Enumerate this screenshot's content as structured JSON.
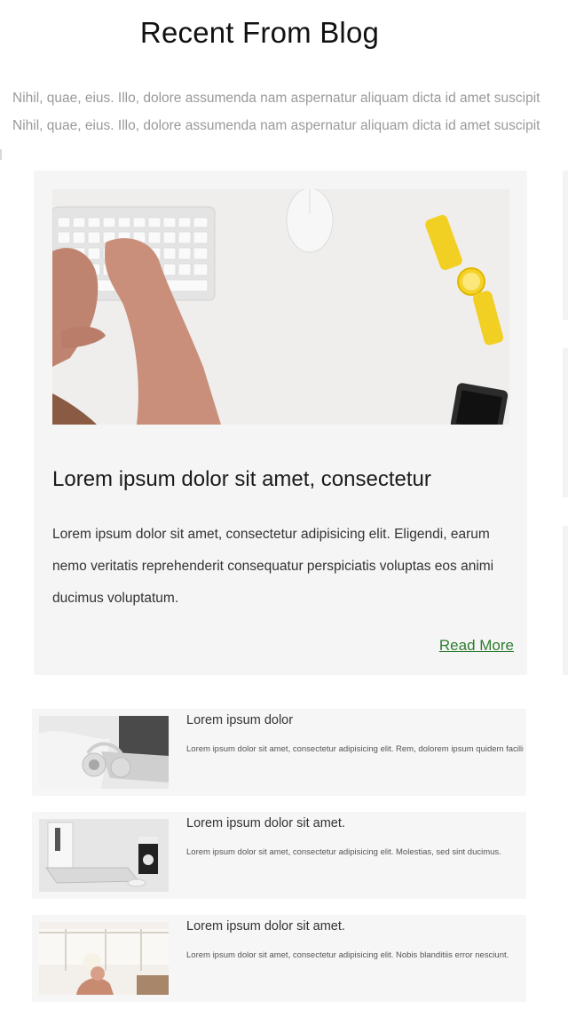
{
  "section": {
    "title": "Recent From Blog",
    "subtitle_lines": [
      "Nihil, quae, eius. Illo, dolore assumenda nam aspernatur aliquam dicta id amet suscipit",
      "Nihil, quae, eius. Illo, dolore assumenda nam aspernatur aliquam dicta id amet suscipit"
    ]
  },
  "featured": {
    "title": "Lorem ipsum dolor sit amet, consectetur",
    "body": "Lorem ipsum dolor sit amet, consectetur adipisicing elit. Eligendi, earum nemo veritatis reprehenderit consequatur perspiciatis voluptas eos animi ducimus voluptatum.",
    "read_more": "Read More",
    "image": "desk-keyboard-hands-photo"
  },
  "posts": [
    {
      "title": "Lorem ipsum dolor",
      "excerpt": "Lorem ipsum dolor sit amet, consectetur adipisicing elit. Rem, dolorem ipsum quidem facilis.",
      "image": "laptop-headphones-photo"
    },
    {
      "title": "Lorem ipsum dolor sit amet.",
      "excerpt": "Lorem ipsum dolor sit amet, consectetur adipisicing elit. Molestias, sed sint ducimus.",
      "image": "laptop-book-photo"
    },
    {
      "title": "Lorem ipsum dolor sit amet.",
      "excerpt": "Lorem ipsum dolor sit amet, consectetur adipisicing elit. Nobis blanditiis error nesciunt.",
      "image": "office-window-photo"
    }
  ],
  "colors": {
    "accent_link": "#2e7d32",
    "card_bg": "#f5f5f5",
    "muted_text": "#9a9a9a"
  }
}
